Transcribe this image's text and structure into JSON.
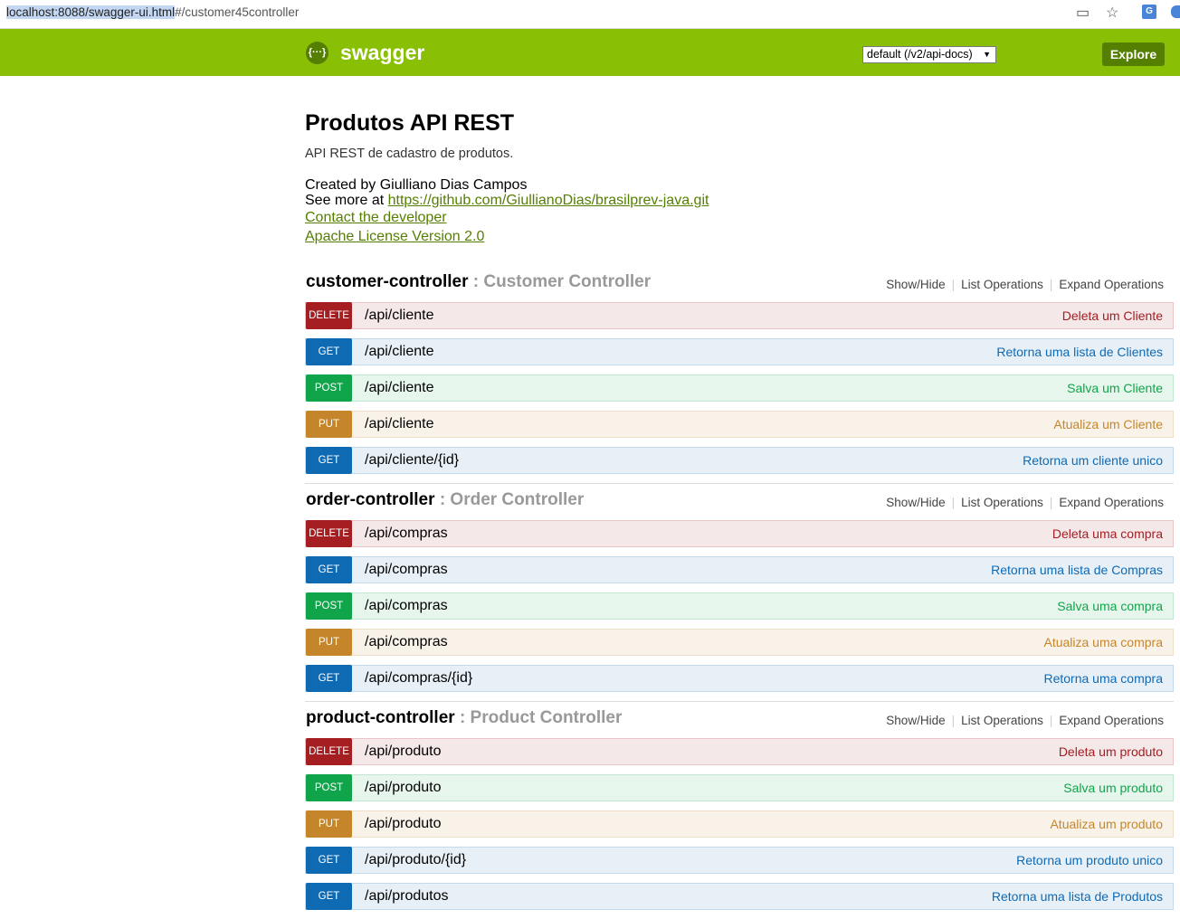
{
  "browser": {
    "url_selected": "localhost:8088/swagger-ui.html",
    "url_rest": "#/customer45controller"
  },
  "header": {
    "logo_glyph": "{···}",
    "brand": "swagger",
    "spec_select": "default (/v2/api-docs)",
    "explore_label": "Explore"
  },
  "info": {
    "title": "Produtos API REST",
    "description": "API REST de cadastro de produtos.",
    "created_by": "Created by Giulliano Dias Campos",
    "see_more_prefix": "See more at ",
    "see_more_link": "https://github.com/GiullianoDias/brasilprev-java.git",
    "contact_link": "Contact the developer",
    "license_link": "Apache License Version 2.0"
  },
  "resource_actions": {
    "show_hide": "Show/Hide",
    "list_operations": "List Operations",
    "expand_operations": "Expand Operations"
  },
  "resources": [
    {
      "name": "customer-controller",
      "description": ": Customer Controller",
      "operations": [
        {
          "method": "DELETE",
          "path": "/api/cliente",
          "summary": "Deleta um Cliente"
        },
        {
          "method": "GET",
          "path": "/api/cliente",
          "summary": "Retorna uma lista de Clientes"
        },
        {
          "method": "POST",
          "path": "/api/cliente",
          "summary": "Salva um Cliente"
        },
        {
          "method": "PUT",
          "path": "/api/cliente",
          "summary": "Atualiza um Cliente"
        },
        {
          "method": "GET",
          "path": "/api/cliente/{id}",
          "summary": "Retorna um cliente unico"
        }
      ]
    },
    {
      "name": "order-controller",
      "description": ": Order Controller",
      "operations": [
        {
          "method": "DELETE",
          "path": "/api/compras",
          "summary": "Deleta uma compra"
        },
        {
          "method": "GET",
          "path": "/api/compras",
          "summary": "Retorna uma lista de Compras"
        },
        {
          "method": "POST",
          "path": "/api/compras",
          "summary": "Salva uma compra"
        },
        {
          "method": "PUT",
          "path": "/api/compras",
          "summary": "Atualiza uma compra"
        },
        {
          "method": "GET",
          "path": "/api/compras/{id}",
          "summary": "Retorna uma compra"
        }
      ]
    },
    {
      "name": "product-controller",
      "description": ": Product Controller",
      "operations": [
        {
          "method": "DELETE",
          "path": "/api/produto",
          "summary": "Deleta um produto"
        },
        {
          "method": "POST",
          "path": "/api/produto",
          "summary": "Salva um produto"
        },
        {
          "method": "PUT",
          "path": "/api/produto",
          "summary": "Atualiza um produto"
        },
        {
          "method": "GET",
          "path": "/api/produto/{id}",
          "summary": "Retorna um produto unico"
        },
        {
          "method": "GET",
          "path": "/api/produtos",
          "summary": "Retorna uma lista de Produtos"
        }
      ]
    }
  ]
}
